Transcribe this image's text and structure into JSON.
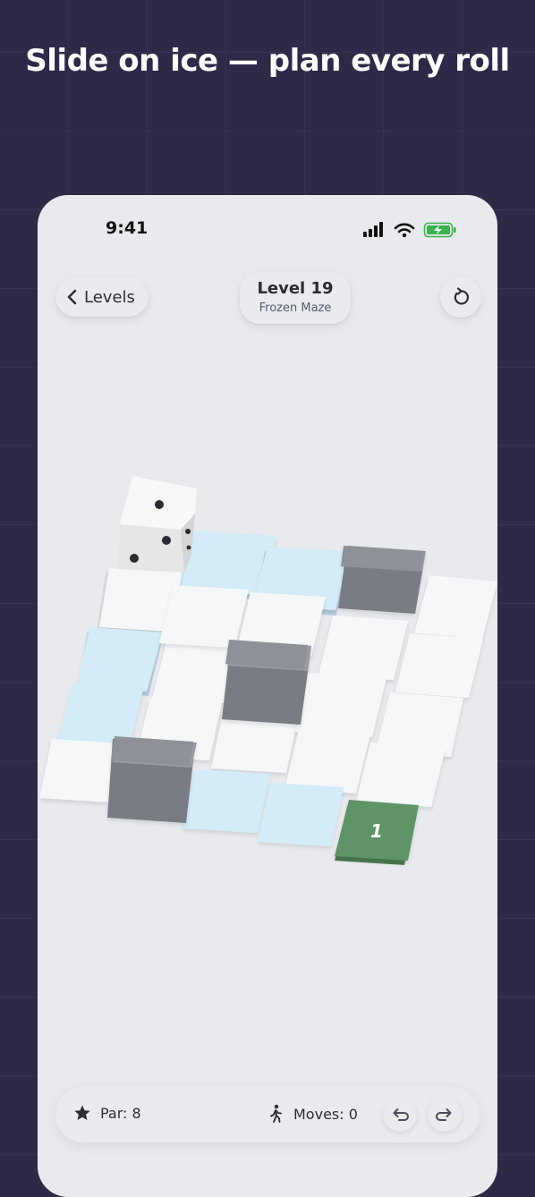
{
  "headline": "Slide on ice — plan every roll",
  "status_bar": {
    "time": "9:41"
  },
  "nav": {
    "back_label": "Levels",
    "level_title": "Level 19",
    "level_subtitle": "Frozen Maze"
  },
  "board": {
    "goal_label": "1",
    "colors": {
      "floor": "#f6f7f9",
      "ice": "#d3ecf7",
      "block": "#8f9198",
      "goal": "#5f9466",
      "die": "#f3f3f3"
    }
  },
  "footer": {
    "par_label": "Par: 8",
    "moves_label": "Moves: 0"
  }
}
